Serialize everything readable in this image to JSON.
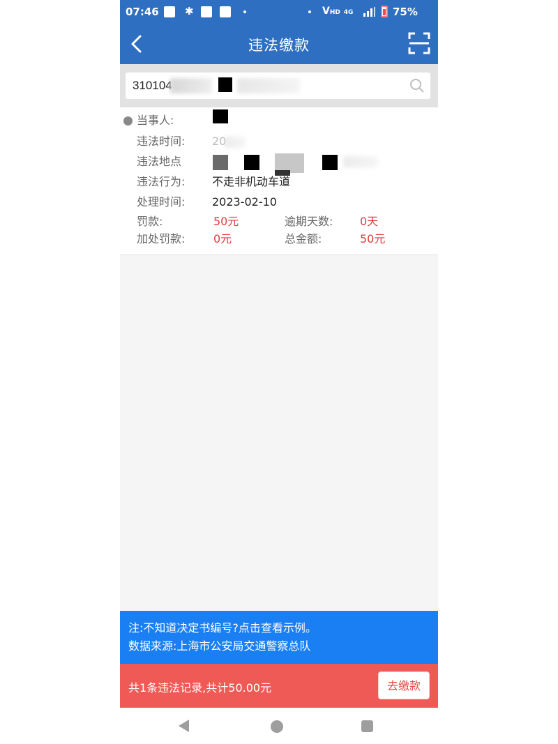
{
  "status_bar": {
    "time": "07:46",
    "network": "V",
    "network_sub": "HD",
    "signal": "4G",
    "battery": "75%"
  },
  "header": {
    "title": "违法缴款"
  },
  "search": {
    "value": "310104"
  },
  "record": {
    "party_label": "当事人:",
    "time_label": "违法时间:",
    "time_value_partial": "20",
    "place_label": "违法地点",
    "action_label": "违法行为:",
    "action_value": "不走非机动车道",
    "process_label": "处理时间:",
    "process_value": "2023-02-10",
    "fine_label": "罚款:",
    "fine_value": "50元",
    "overdue_label": "逾期天数:",
    "overdue_value": "0天",
    "extra_label": "加处罚款:",
    "extra_value": "0元",
    "total_label": "总金额:",
    "total_value": "50元"
  },
  "note": {
    "line1": "注:不知道决定书编号?点击查看示例。",
    "line2": "数据来源:上海市公安局交通警察总队"
  },
  "pay": {
    "summary": "共1条违法记录,共计50.00元",
    "button_label": "去缴款"
  },
  "colors": {
    "primary_blue": "#2f6fc2",
    "note_blue": "#1a7ff2",
    "pay_red": "#ef5a56",
    "amount_red": "#e23a3a"
  },
  "icons": {
    "back": "chevron-left-icon",
    "scan": "scan-icon",
    "search": "search-icon"
  }
}
